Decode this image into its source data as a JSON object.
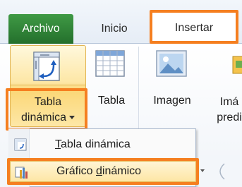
{
  "tabs": {
    "file": "Archivo",
    "home": "Inicio",
    "insert": "Insertar"
  },
  "ribbon": {
    "pivot_line1": "Tabla",
    "pivot_line2": "dinámica",
    "table": "Tabla",
    "image": "Imagen",
    "clipart_line1": "Imá",
    "clipart_line2": "predi"
  },
  "dropdown": {
    "item1_prefix": "",
    "item1_mnemonic": "T",
    "item1_rest": "abla dinámica",
    "item2_prefix": "Gráfico ",
    "item2_mnemonic": "d",
    "item2_rest": "inámico"
  },
  "colors": {
    "highlight": "#f57f20",
    "file_tab": "#2e8a36",
    "hover": "#fde7a6"
  },
  "icons": {
    "pivot": "pivot-table-icon",
    "table": "table-icon",
    "image": "picture-icon",
    "clipart": "clip-art-icon",
    "dropdown_arrow": "chevron-down-icon"
  }
}
